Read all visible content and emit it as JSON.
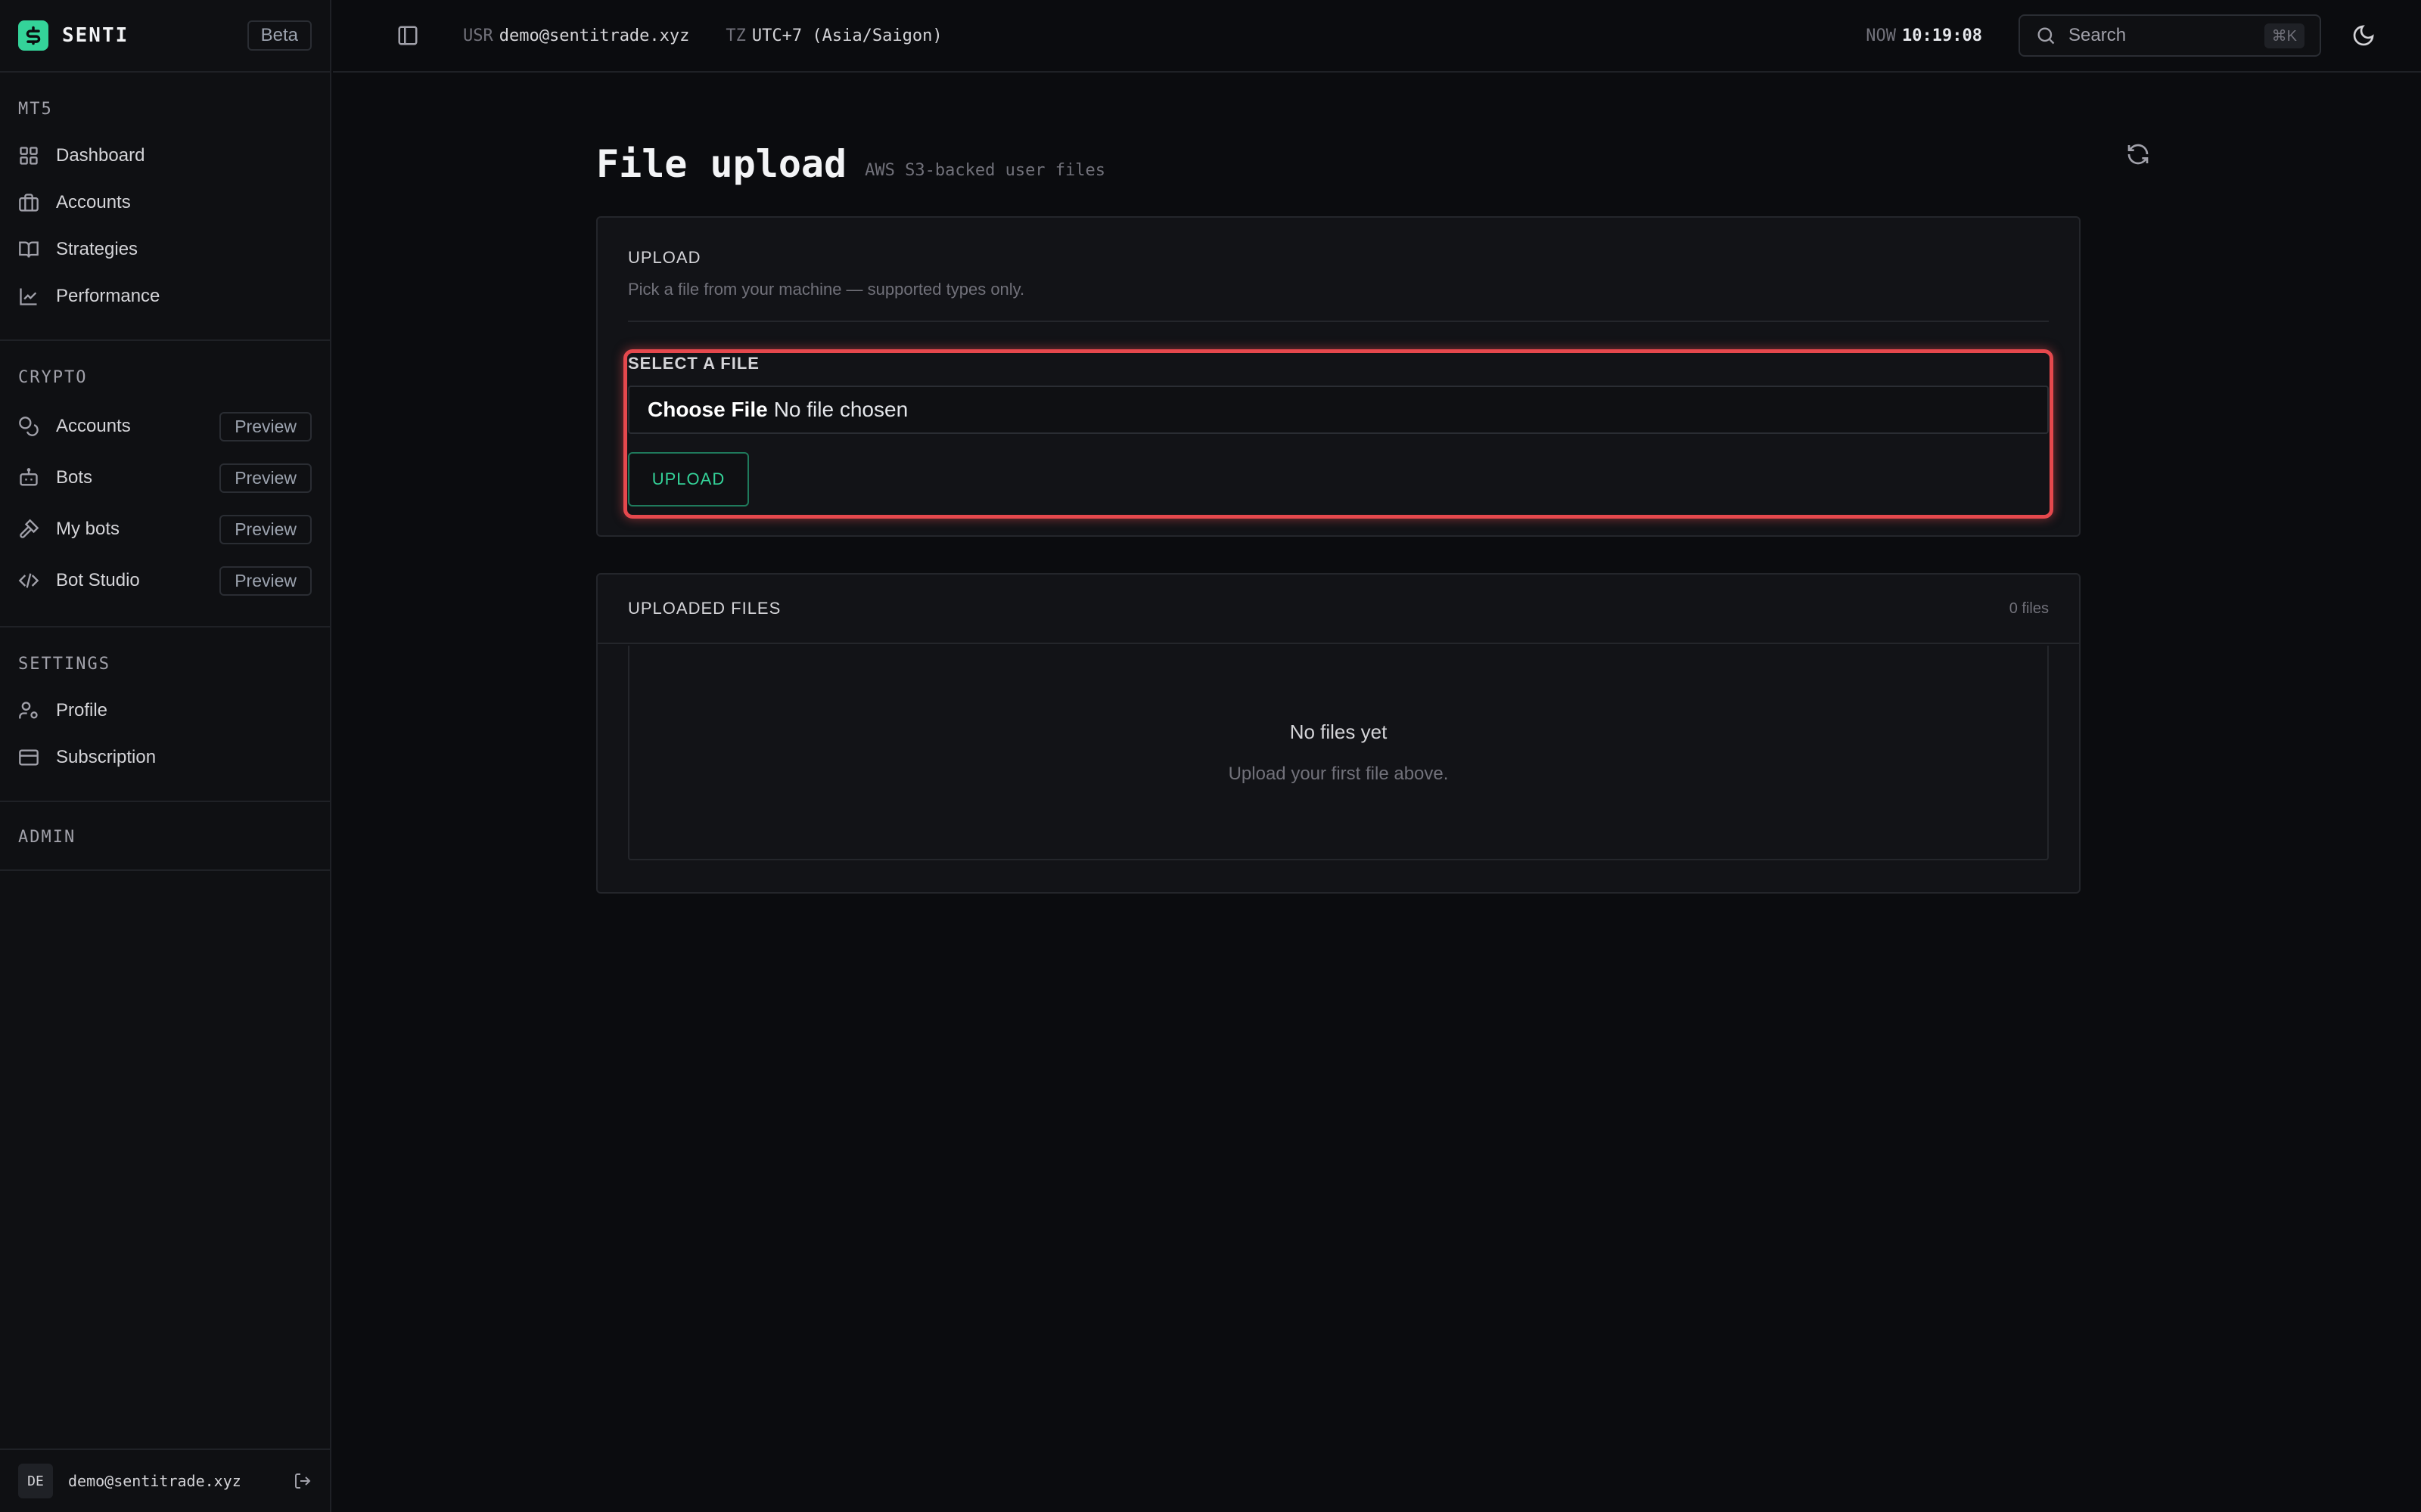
{
  "brand": {
    "name": "SENTI",
    "badge": "Beta"
  },
  "sidebar": {
    "mt5": {
      "title": "MT5",
      "items": [
        {
          "label": "Dashboard",
          "icon": "dashboard-icon"
        },
        {
          "label": "Accounts",
          "icon": "briefcase-icon"
        },
        {
          "label": "Strategies",
          "icon": "book-icon"
        },
        {
          "label": "Performance",
          "icon": "chart-line-icon"
        }
      ]
    },
    "crypto": {
      "title": "CRYPTO",
      "items": [
        {
          "label": "Accounts",
          "icon": "coins-icon",
          "badge": "Preview"
        },
        {
          "label": "Bots",
          "icon": "bot-icon",
          "badge": "Preview"
        },
        {
          "label": "My bots",
          "icon": "hammer-icon",
          "badge": "Preview"
        },
        {
          "label": "Bot Studio",
          "icon": "code-icon",
          "badge": "Preview"
        }
      ]
    },
    "settings": {
      "title": "SETTINGS",
      "items": [
        {
          "label": "Profile",
          "icon": "user-cog-icon"
        },
        {
          "label": "Subscription",
          "icon": "card-icon"
        }
      ]
    },
    "admin": {
      "title": "ADMIN"
    },
    "footer": {
      "avatar": "DE",
      "email": "demo@sentitrade.xyz"
    }
  },
  "topbar": {
    "user_key": "USR",
    "user_value": "demo@sentitrade.xyz",
    "tz_key": "TZ",
    "tz_value": "UTC+7 (Asia/Saigon)",
    "now_key": "NOW",
    "now_value": "10:19:08",
    "search_placeholder": "Search",
    "search_shortcut": "⌘K"
  },
  "page": {
    "title": "File upload",
    "subtitle": "AWS S3-backed user files"
  },
  "upload": {
    "label": "UPLOAD",
    "description": "Pick a file from your machine — supported types only.",
    "field_label": "SELECT A FILE",
    "choose_button": "Choose File",
    "no_file": "No file chosen",
    "submit": "UPLOAD"
  },
  "files": {
    "label": "UPLOADED FILES",
    "count": "0 files",
    "empty_title": "No files yet",
    "empty_subtitle": "Upload your first file above."
  },
  "colors": {
    "accent": "#34d399",
    "highlight": "#e5484d",
    "background": "#0b0c0f"
  }
}
